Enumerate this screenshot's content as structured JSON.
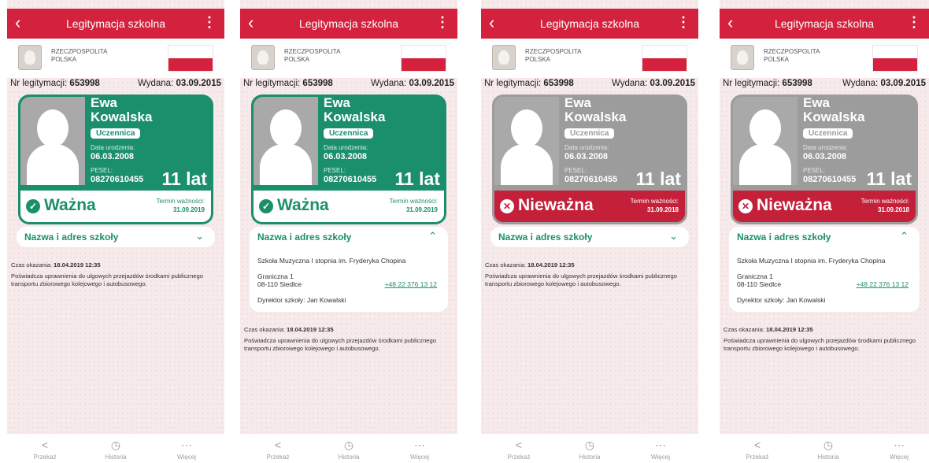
{
  "app": {
    "title": "Legitymacja szkolna",
    "back_icon": "chevron-left-icon",
    "menu_icon": "more-vertical-icon",
    "issuer_line1": "RZECZPOSPOLITA",
    "issuer_line2": "POLSKA"
  },
  "id": {
    "number_label": "Nr legitymacji:",
    "number": "653998",
    "issued_label": "Wydana:",
    "issued": "03.09.2015"
  },
  "person": {
    "first_name": "Ewa",
    "last_name": "Kowalska",
    "role": "Uczennica",
    "dob_label": "Data urodzenia:",
    "dob": "06.03.2008",
    "pesel_label": "PESEL:",
    "pesel": "08270610455",
    "age": "11 lat"
  },
  "status_valid": {
    "label": "Ważna",
    "expiry_label": "Termin ważności:",
    "expiry": "31.09.2019",
    "icon": "check-circle-icon"
  },
  "status_invalid": {
    "label": "Nieważna",
    "expiry_label": "Termin ważności:",
    "expiry": "31.09.2018",
    "icon": "x-circle-icon"
  },
  "school": {
    "section_title": "Nazwa i adres szkoły",
    "name": "Szkoła Muzyczna I stopnia im. Fryderyka Chopina",
    "street": "Graniczna 1",
    "city": "08-110 Siedlce",
    "phone": "+48 22 376 13 12",
    "director": "Dyrektor szkoły: Jan Kowalski"
  },
  "info": {
    "time_label": "Czas okazania:",
    "time": "18.04.2019 12:35",
    "text": "Poświadcza uprawnienia do ulgowych przejazdów środkami publicznego transportu zbiorowego kolejowego i autobusowego."
  },
  "tabs": [
    {
      "label": "Przekaż",
      "icon": "share-icon"
    },
    {
      "label": "Historia",
      "icon": "history-icon"
    },
    {
      "label": "Więcej",
      "icon": "more-horizontal-icon"
    }
  ],
  "colors": {
    "brand_red": "#d4213d",
    "valid_green": "#1b8f6b",
    "invalid_gray": "#9c9c9c"
  }
}
